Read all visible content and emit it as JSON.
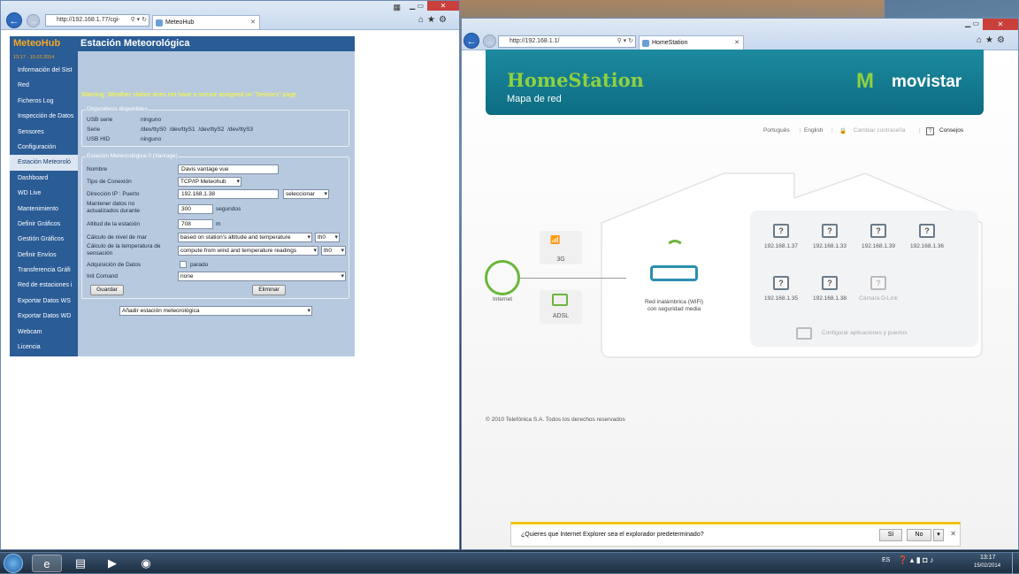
{
  "left_window": {
    "address": "http://192.168.1.77/cgi-",
    "tab_title": "MeteoHub",
    "meteohub": {
      "logo": "MeteoHub",
      "datetime": "13:17 · 15.02.2014",
      "page_title": "Estación Meteorológica",
      "menu": [
        "Información del Sist",
        "Red",
        "Ficheros Log",
        "Inspección de Datos",
        "Sensores",
        "Configuración",
        "Estación Meteoroló",
        "Dashboard",
        "WD Live",
        "Mantenimiento",
        "Definir Gráficos",
        "Gestión Gráficos",
        "Definir Envíos",
        "Transferencia Gráfi",
        "Red de estaciones i",
        "Exportar Datos WS",
        "Exportar Datos WD",
        "Webcam",
        "Licencia"
      ],
      "warning": "Warning: Weather station does not have a sensor assigned on \"Sensors\" page",
      "devices": {
        "legend": "Dispositivos disponibles",
        "rows": [
          {
            "label": "USB serie",
            "value": "ninguno"
          },
          {
            "label": "Serie",
            "value": "/dev/ttyS0   /dev/ttyS1   /dev/ttyS2   /dev/ttyS3"
          },
          {
            "label": "USB HID",
            "value": "ninguno"
          }
        ]
      },
      "station": {
        "legend": "Estación Meteorológica 0 (Vantage)",
        "nombre_label": "Nombre",
        "nombre_value": "Davis vantage vue",
        "conexion_label": "Tipo de Conexión",
        "conexion_value": "TCP/IP Meteohub",
        "ip_label": "Dirección IP : Puerto",
        "ip_value": "192.168.1.38",
        "ip_select": "seleccionar",
        "mantener_label": "Mantener datos no actualizados durante",
        "mantener_value": "300",
        "mantener_unit": "segundos",
        "altitud_label": "Altitud de la estación",
        "altitud_value": "708",
        "altitud_unit": "m",
        "nivel_label": "Cálculo de nivel de mar",
        "nivel_value": "based on station's altitude and temperature",
        "nivel_sensor": "th0",
        "sensacion_label": "Cálculo de la temperatura de sensación",
        "sensacion_value": "compute from wind and temperature readings",
        "sensacion_sensor": "th0",
        "adq_label": "Adquisición de Datos",
        "adq_value": "parado",
        "init_label": "Init Comand",
        "init_value": "none",
        "save": "Guardar",
        "delete": "Eliminar"
      },
      "add_station": "Añadir estación meteorológica"
    }
  },
  "right_window": {
    "address": "http://192.168.1.1/",
    "tab_title": "HomeStation",
    "brand_title": "HomeStation",
    "brand_subtitle": "Mapa de red",
    "brand_logo": "movistar",
    "links": [
      "Português",
      "English",
      "Cambiar contraseña",
      "Consejos"
    ],
    "internet": "Internet",
    "conn_3g": "3G",
    "conn_adsl": "ADSL",
    "router_label_1": "Red inalámbrica (WiFi)",
    "router_label_2": "con seguridad media",
    "devices": [
      "192.168.1.37",
      "192.168.1.33",
      "192.168.1.39",
      "192.168.1.36",
      "192.168.1.35",
      "192.168.1.38",
      "Cámara D-Link"
    ],
    "config_link": "Configurar aplicaciones y puertos",
    "footer": "© 2010 Telefónica S.A. Todos los derechos reservados",
    "notification": {
      "text": "¿Quieres que Internet Explorer sea el explorador predeterminado?",
      "yes": "Sí",
      "no": "No"
    }
  },
  "taskbar": {
    "lang": "ES",
    "time": "13:17",
    "date": "15/02/2014"
  }
}
